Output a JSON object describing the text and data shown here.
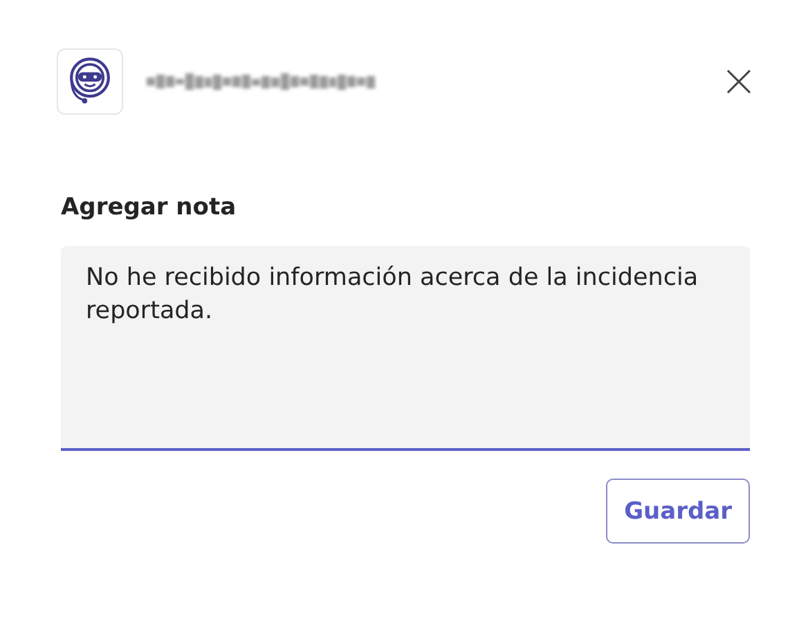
{
  "dialog": {
    "title_redacted": true
  },
  "note": {
    "label": "Agregar nota",
    "value": "No he recibido información acerca de la incidencia reportada."
  },
  "buttons": [
    {
      "label": "Guardar",
      "kind": "outline"
    }
  ]
}
